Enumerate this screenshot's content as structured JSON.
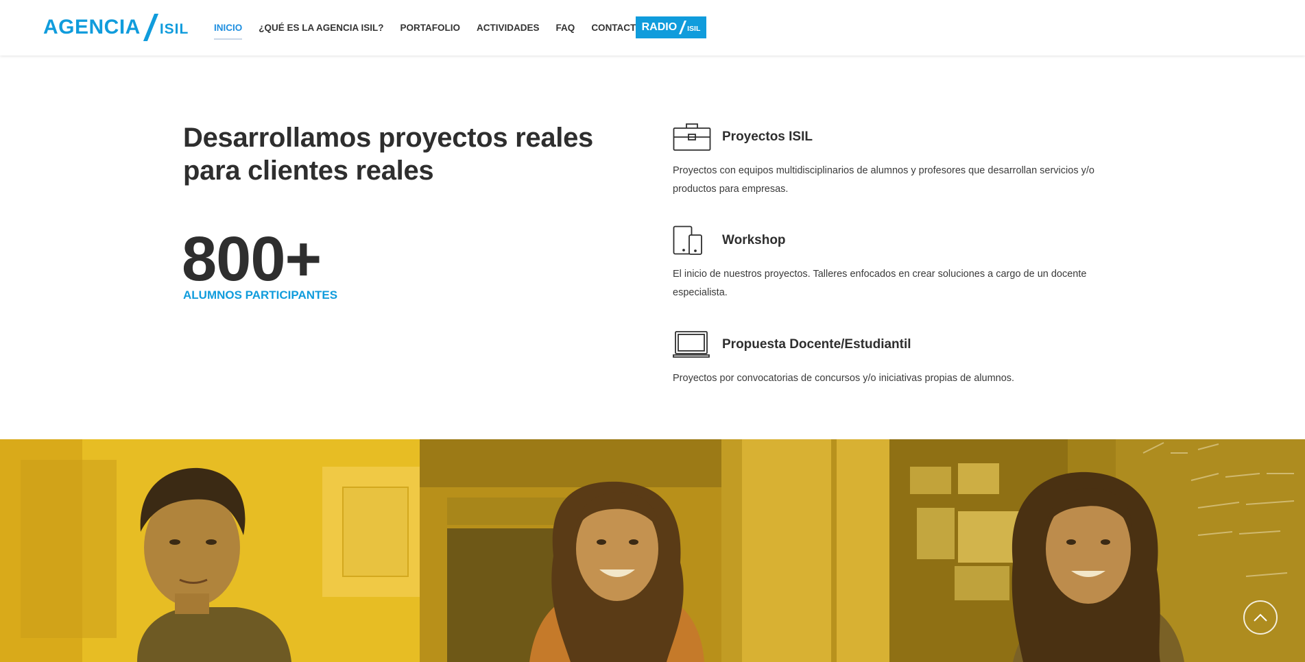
{
  "header": {
    "logo": {
      "main": "AGENCIA",
      "sub": "ISIL"
    },
    "nav": [
      {
        "label": "INICIO",
        "active": true
      },
      {
        "label": "¿QUÉ ES LA AGENCIA ISIL?",
        "active": false
      },
      {
        "label": "PORTAFOLIO",
        "active": false
      },
      {
        "label": "ACTIVIDADES",
        "active": false
      },
      {
        "label": "FAQ",
        "active": false
      },
      {
        "label": "CONTACTO",
        "active": false
      }
    ],
    "radio": {
      "main": "RADIO",
      "sub": "ISIL"
    }
  },
  "hero": {
    "headline_line1": "Desarrollamos proyectos reales",
    "headline_line2": "para clientes reales",
    "stat_value": "800+",
    "stat_label": "ALUMNOS PARTICIPANTES"
  },
  "features": [
    {
      "icon": "briefcase-icon",
      "title": "Proyectos ISIL",
      "description": "Proyectos con equipos multidisciplinarios de alumnos y profesores que desarrollan servicios y/o productos para empresas."
    },
    {
      "icon": "devices-icon",
      "title": "Workshop",
      "description": "El inicio de nuestros proyectos. Talleres enfocados en crear soluciones a cargo de un docente especialista."
    },
    {
      "icon": "laptop-icon",
      "title": "Propuesta Docente/Estudiantil",
      "description": "Proyectos por convocatorias de concursos y/o iniciativas propias de alumnos."
    }
  ],
  "colors": {
    "brand_blue": "#109cdc",
    "active_nav": "#1f8fe0",
    "photo_tint": "#d5aa1c"
  },
  "scroll_top_icon": "chevron-up-icon"
}
